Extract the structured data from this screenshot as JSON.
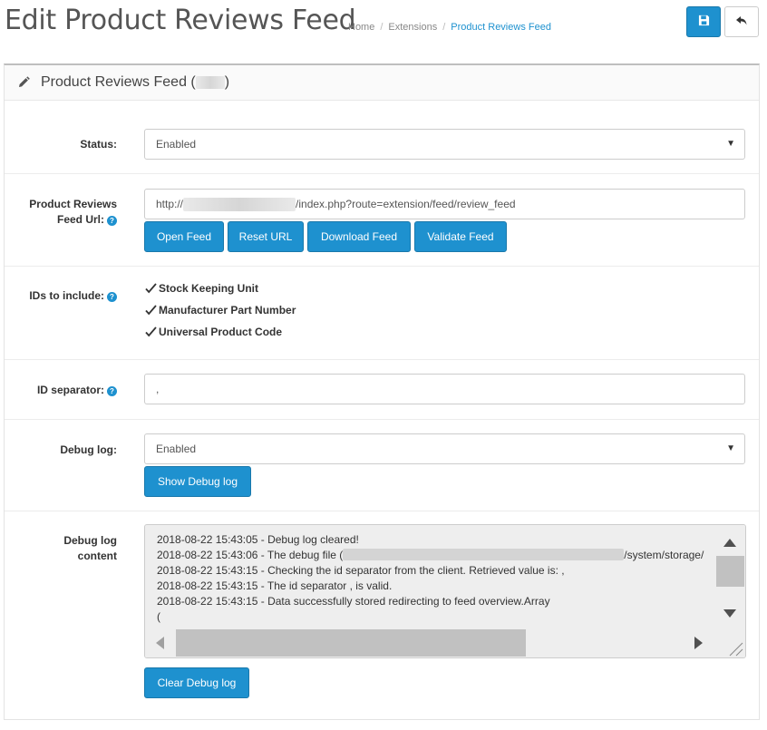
{
  "header": {
    "title": "Edit Product Reviews Feed",
    "breadcrumbs": [
      "Home",
      "Extensions",
      "Product Reviews Feed"
    ],
    "breadcrumb_separator": "/",
    "accent_color": "#1e91cf"
  },
  "panel": {
    "heading": "Product Reviews Feed (",
    "heading_close": ")"
  },
  "form": {
    "status": {
      "label": "Status:",
      "value": "Enabled"
    },
    "feed_url": {
      "label_line1": "Product Reviews",
      "label_line2": "Feed Url:",
      "value_prefix": "http://",
      "value_suffix": "/index.php?route=extension/feed/review_feed",
      "buttons": [
        "Open Feed",
        "Reset URL",
        "Download Feed",
        "Validate Feed"
      ]
    },
    "ids": {
      "label": "IDs to include:",
      "options": [
        {
          "label": "Stock Keeping Unit",
          "checked": true
        },
        {
          "label": "Manufacturer Part Number",
          "checked": true
        },
        {
          "label": "Universal Product Code",
          "checked": true
        }
      ]
    },
    "id_separator": {
      "label": "ID separator:",
      "value": ","
    },
    "debug_log": {
      "label": "Debug log:",
      "value": "Enabled",
      "button": "Show Debug log"
    },
    "debug_content": {
      "label_line1": "Debug log",
      "label_line2": "content",
      "lines": [
        "2018-08-22 15:43:05 - Debug log cleared!",
        "2018-08-22 15:43:06 - The debug file (",
        "2018-08-22 15:43:15 - Checking the id separator from the client. Retrieved value is: ,",
        "2018-08-22 15:43:15 - The id separator , is valid.",
        "2018-08-22 15:43:15 - Data successfully stored redirecting to feed overview.Array",
        "("
      ],
      "line2_suffix": "/system/storage/",
      "button": "Clear Debug log"
    }
  }
}
